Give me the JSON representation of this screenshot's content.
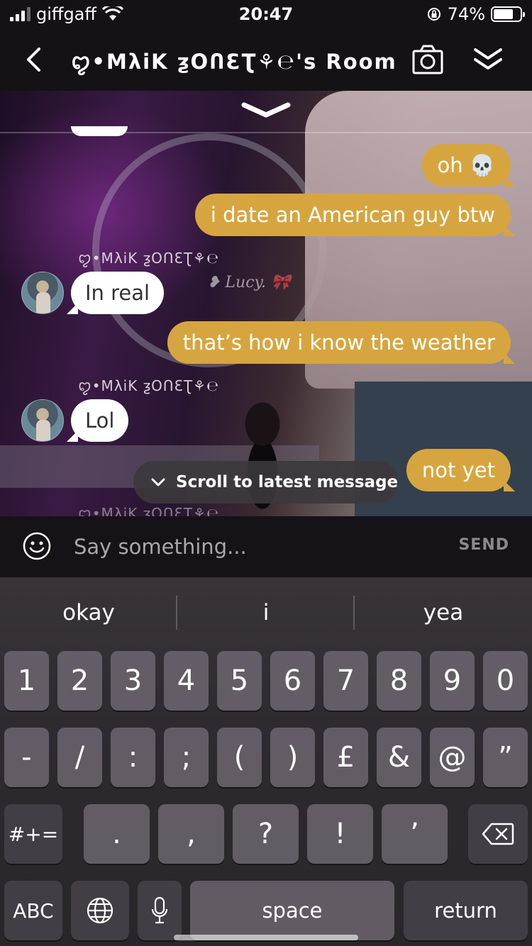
{
  "status_bar": {
    "carrier": "giffgaff",
    "time": "20:47",
    "battery_percent": "74%",
    "battery_level": 0.74
  },
  "header": {
    "room_title": "ꨄ•MλiK ƺOՈƐƮ⚘℮'s Room",
    "icons": [
      "chevron-left-icon",
      "camera-icon",
      "double-chevron-down-icon"
    ]
  },
  "chat": {
    "sender_name": "ꨄ•MλiK ƺOՈƐƮ⚘℮",
    "messages": [
      {
        "side": "right",
        "text": "oh 💀"
      },
      {
        "side": "right",
        "text": "i date an American guy btw"
      },
      {
        "side": "left",
        "text": "In real"
      },
      {
        "side": "right",
        "text": "that’s how i know the weather"
      },
      {
        "side": "left",
        "text": "Lol"
      },
      {
        "side": "right",
        "text": "not yet"
      }
    ],
    "scene_text": "❥ Lucy. 🎀",
    "scroll_latest_label": "Scroll to latest message"
  },
  "input": {
    "placeholder": "Say something...",
    "send_label": "SEND"
  },
  "keyboard": {
    "suggestions": [
      "okay",
      "i",
      "yea"
    ],
    "row1": [
      "1",
      "2",
      "3",
      "4",
      "5",
      "6",
      "7",
      "8",
      "9",
      "0"
    ],
    "row2": [
      "-",
      "/",
      ":",
      ";",
      "(",
      ")",
      "£",
      "&",
      "@",
      "”"
    ],
    "row3": [
      ".",
      ",",
      "?",
      "!",
      "’"
    ],
    "symbols_key": "#+=",
    "abc_key": "ABC",
    "space_key": "space",
    "return_key": "return"
  },
  "colors": {
    "outgoing_bubble": "#d7a53f",
    "incoming_bubble": "#ffffff",
    "header_bg": "#141214"
  }
}
